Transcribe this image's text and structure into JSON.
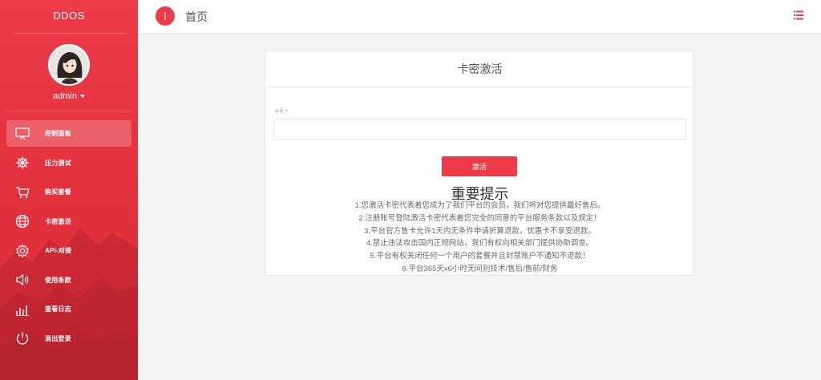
{
  "sidebar": {
    "brand": "DDOS",
    "user": {
      "name": "admin"
    },
    "items": [
      {
        "label": "控制面板",
        "icon": "monitor-icon",
        "active": true
      },
      {
        "label": "压力测试",
        "icon": "ship-wheel-icon",
        "active": false
      },
      {
        "label": "购买套餐",
        "icon": "cart-icon",
        "active": false
      },
      {
        "label": "卡密激活",
        "icon": "globe-icon",
        "active": false
      },
      {
        "label": "API-对接",
        "icon": "gear-icon",
        "active": false
      },
      {
        "label": "使用条款",
        "icon": "speaker-icon",
        "active": false
      },
      {
        "label": "查看日志",
        "icon": "bar-chart-icon",
        "active": false
      },
      {
        "label": "退出登录",
        "icon": "power-icon",
        "active": false
      }
    ]
  },
  "topbar": {
    "title": "首页",
    "menu_toggle_icon": "menu-toggle-icon",
    "right_icon": "list-icon"
  },
  "card": {
    "title": "卡密激活",
    "field": {
      "label": "卡号",
      "required_mark": "*",
      "value": "",
      "placeholder": ""
    },
    "button_label": "激活",
    "notice_title": "重要提示",
    "notice_lines": [
      "1.您激活卡密代表着您成为了我们平台的会员，我们将对您提供最好售后。",
      "2.注册账号登陆激活卡密代表着您完全的同意的平台服务条款以及规定！",
      "3.平台官方售卡允许1天内无条件申请折算退款，优惠卡不享受退款。",
      "4.禁止违法攻击国内正规网站，我们有权向相关部门提供协助调查。",
      "5.平台有权关闭任何一个用户的套餐并且封禁账户不通知不退款！",
      "6.平台365天x6小时无间别技术/售后/售前/财务"
    ]
  },
  "colors": {
    "accent": "#ee3b4a",
    "background": "#f3f3f4"
  }
}
